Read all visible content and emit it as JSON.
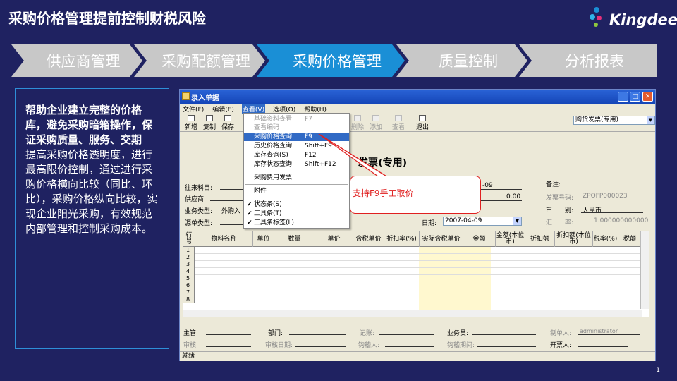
{
  "slide": {
    "title": "采购价格管理提前控制财税风险",
    "logo_text": "Kingdee",
    "page_number": "1"
  },
  "steps": [
    {
      "label": "供应商管理",
      "active": false
    },
    {
      "label": "采购配额管理",
      "active": false
    },
    {
      "label": "采购价格管理",
      "active": true
    },
    {
      "label": "质量控制",
      "active": false
    },
    {
      "label": "分析报表",
      "active": false
    }
  ],
  "left_panel": {
    "heading": "帮助企业建立完整的价格库，避免采购暗箱操作，保证采购质量、服务、交期",
    "body": "提高采购价格透明度，进行最高限价控制，通过进行采购价格横向比较（同比、环比），采购价格纵向比较，实现企业阳光采购，有效规范内部管理和控制采购成本。"
  },
  "window": {
    "title": "录入单据",
    "menu": [
      "文件(F)",
      "编辑(E)",
      "查看(V)",
      "选项(O)",
      "帮助(H)"
    ],
    "toolbar": [
      "新增",
      "复制",
      "保存",
      "删除",
      "添加",
      "查看",
      "退出"
    ],
    "doc_type": "购货发票(专用)",
    "doc_title": "发票(专用)",
    "fields": {
      "supplier_account_label": "往来科目:",
      "supplier_label": "供应商",
      "business_type_label": "业务类型:",
      "business_type_value": "外购入",
      "source_type_label": "源单类型:",
      "date_partial": "-09",
      "amount": "0.00",
      "date_label": "日期:",
      "date_value": "2007-04-09",
      "remark_label": "备注:",
      "invoice_no_label": "发票号码:",
      "invoice_no_value": "ZPOFP000023",
      "currency_label": "币　　别:",
      "currency_value": "人民币",
      "rate_label": "汇　　率:",
      "rate_value": "1.000000000000"
    },
    "grid": {
      "columns": [
        "行号",
        "物料名称",
        "单位",
        "数量",
        "单价",
        "含税单价",
        "折扣率(%)",
        "实际含税单价",
        "金额",
        "金额(本位币)",
        "折扣额",
        "折扣额(本位币)",
        "税率(%)",
        "税额"
      ],
      "rows": [
        "1",
        "2",
        "3",
        "4",
        "5",
        "6",
        "7",
        "8"
      ]
    },
    "footer": {
      "manager_label": "主管:",
      "dept_label": "部门:",
      "bookkeeper_label": "记账:",
      "salesperson_label": "业务员:",
      "maker_label": "制单人:",
      "maker_value": "administrator",
      "auditor_label": "审核:",
      "audit_date_label": "审核日期:",
      "hook_person_label": "钩稽人:",
      "hook_date_label": "钩稽期间:",
      "invoicer_label": "开票人:"
    },
    "status": "就绪"
  },
  "dropdown": {
    "items": [
      {
        "label": "基础资料查看",
        "shortcut": "F7",
        "disabled": true
      },
      {
        "label": "查看编码",
        "shortcut": "",
        "disabled": true
      },
      {
        "label": "采购价格查询",
        "shortcut": "F9",
        "selected": true
      },
      {
        "label": "历史价格查询",
        "shortcut": "Shift+F9"
      },
      {
        "label": "库存查询(S)",
        "shortcut": "F12"
      },
      {
        "label": "库存状态查询",
        "shortcut": "Shift+F12"
      },
      {
        "label": "采购费用发票",
        "shortcut": ""
      },
      {
        "label": "附件",
        "shortcut": ""
      },
      {
        "label": "状态条(S)",
        "shortcut": "",
        "checked": true
      },
      {
        "label": "工具条(T)",
        "shortcut": "",
        "checked": true
      },
      {
        "label": "工具条标签(L)",
        "shortcut": "",
        "checked": true
      }
    ]
  },
  "callout": {
    "text": "支持F9手工取价"
  },
  "colors": {
    "background": "#1f2261",
    "active_step": "#1a8fd6",
    "inactive_step": "#c8c8c8",
    "callout_red": "#e02020"
  }
}
